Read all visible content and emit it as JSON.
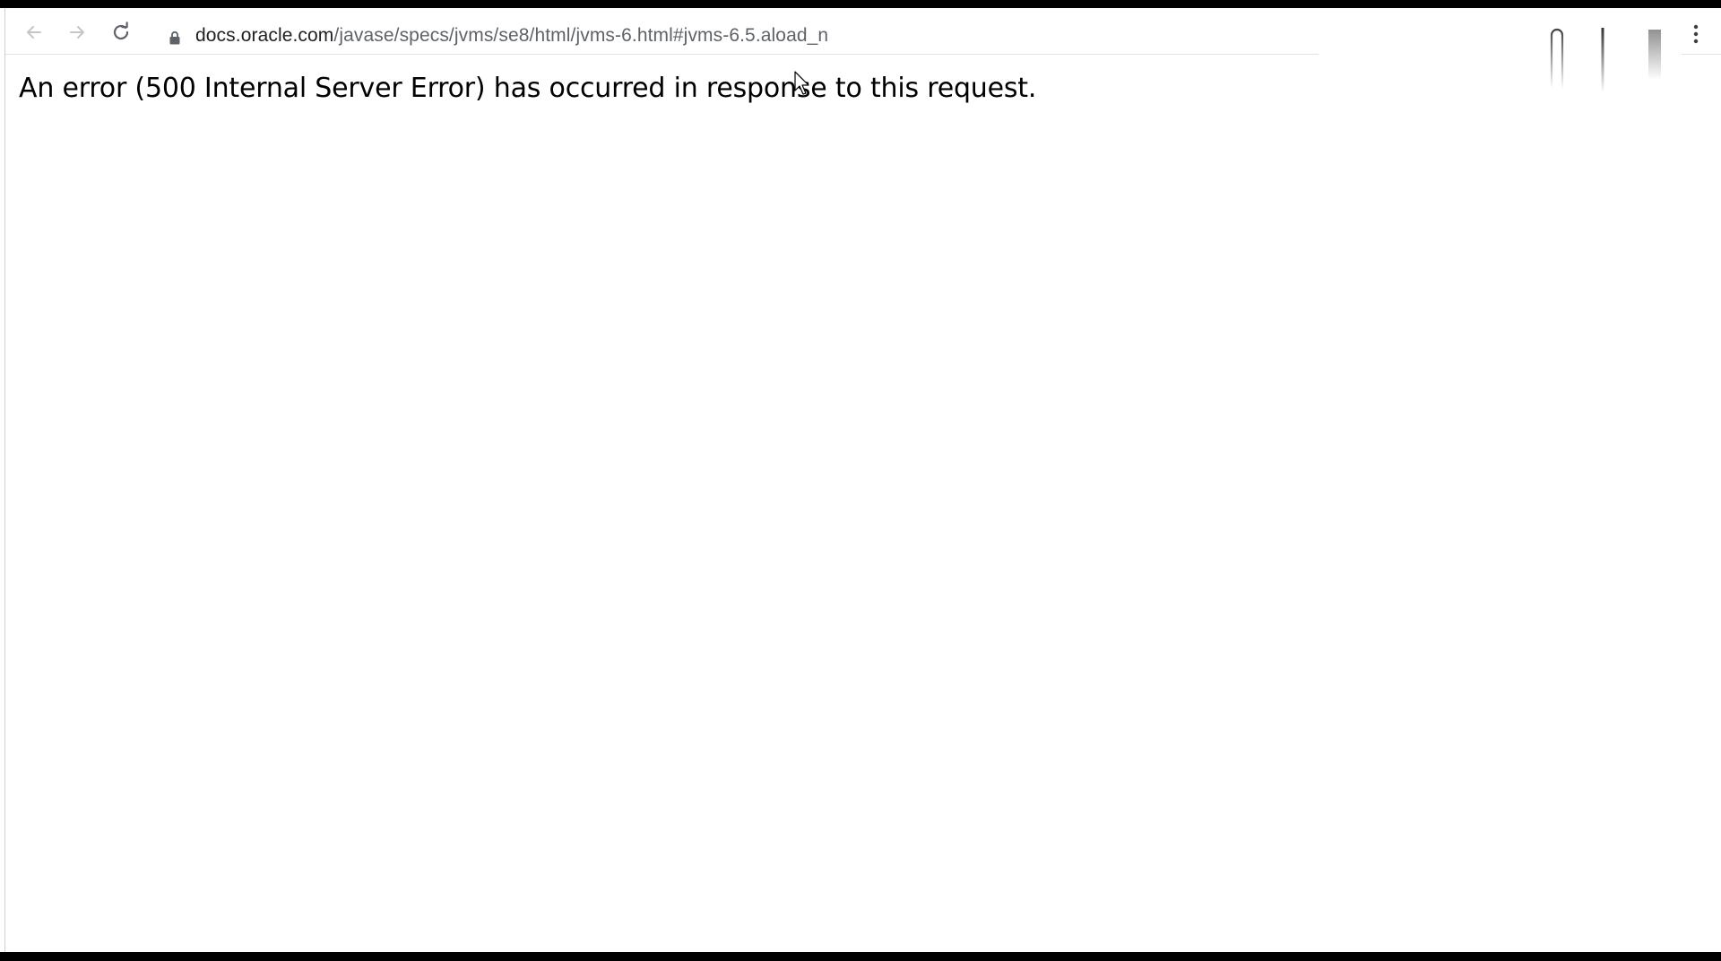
{
  "browser": {
    "url_host": "docs.oracle.com",
    "url_path": "/javase/specs/jvms/se8/html/jvms-6.html#jvms-6.5.aload_n",
    "icons": {
      "back": "arrow-left-icon",
      "forward": "arrow-right-icon",
      "reload": "reload-icon",
      "secure": "lock-icon",
      "menu": "kebab-menu-icon"
    }
  },
  "page": {
    "error_message": "An error (500 Internal Server Error) has occurred in response to this request."
  },
  "colors": {
    "frame": "#000000",
    "page_background": "#ffffff",
    "url_host": "#202124",
    "url_path": "#5f6368",
    "nav_disabled": "#c4c7c5",
    "nav_enabled": "#5f6368"
  }
}
